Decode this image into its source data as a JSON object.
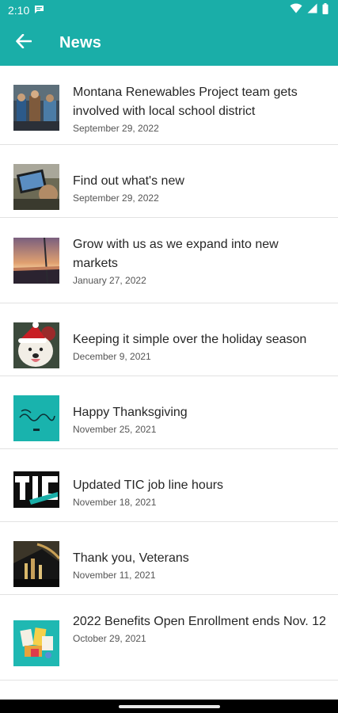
{
  "status_bar": {
    "time": "2:10"
  },
  "app_bar": {
    "title": "News"
  },
  "news": [
    {
      "title": "Montana Renewables Project team gets involved with local school district",
      "date": "September 29, 2022"
    },
    {
      "title": "Find out what's new",
      "date": "September 29, 2022"
    },
    {
      "title": "Grow with us as we expand into new markets",
      "date": "January 27, 2022"
    },
    {
      "title": "Keeping it simple over the holiday season",
      "date": "December 9, 2021"
    },
    {
      "title": "Happy Thanksgiving",
      "date": "November 25, 2021"
    },
    {
      "title": "Updated TIC job line hours",
      "date": "November 18, 2021"
    },
    {
      "title": "Thank you, Veterans",
      "date": "November 11, 2021"
    },
    {
      "title": "2022 Benefits Open Enrollment ends Nov. 12",
      "date": "October 29, 2021"
    }
  ],
  "colors": {
    "accent": "#1aaea8",
    "divider": "#e2e2e2"
  }
}
